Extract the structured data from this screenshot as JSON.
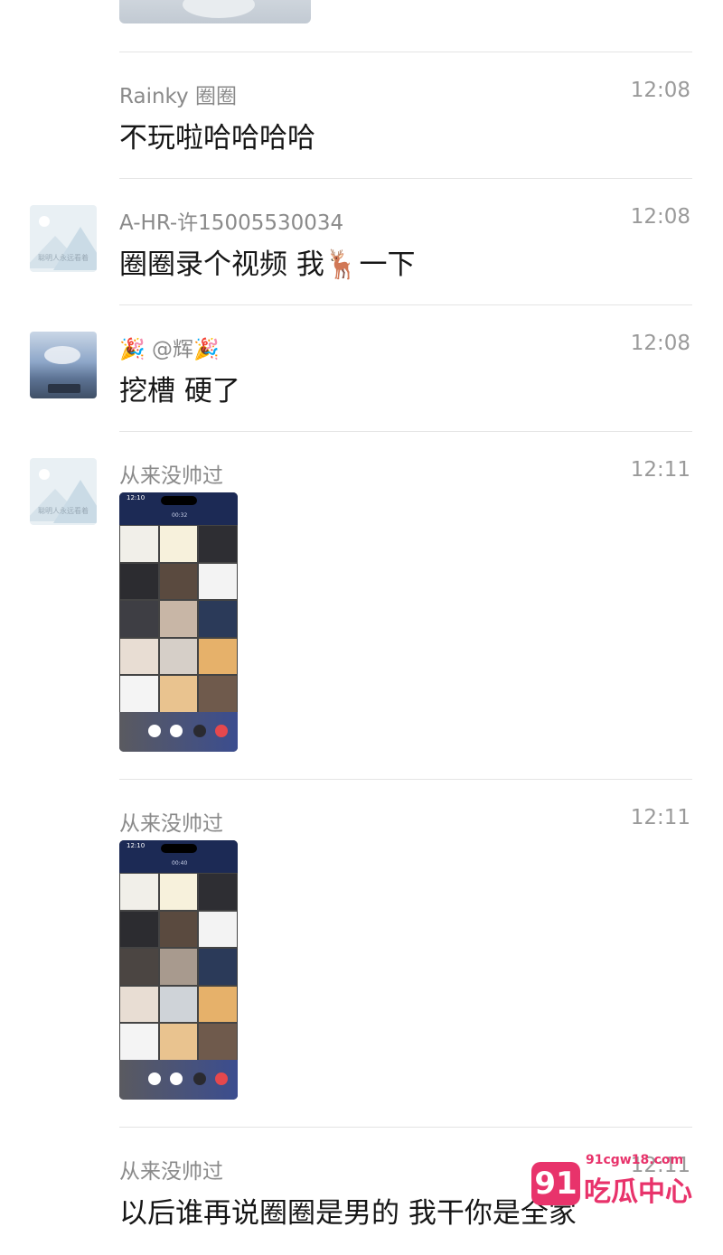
{
  "messages": [
    {
      "name": "Rainky 圈圈",
      "time": "12:08",
      "text": "不玩啦哈哈哈哈"
    },
    {
      "name": "A-HR-许15005530034",
      "time": "12:08",
      "text": "圈圈录个视频 我🦌一下",
      "avatar_caption": "聪明人永远看着"
    },
    {
      "name": "🎉 @辉🎉",
      "time": "12:08",
      "text": "挖槽 硬了"
    },
    {
      "name": "从来没帅过",
      "time": "12:11",
      "avatar_caption": "聪明人永远看着",
      "shot": {
        "clock": "12:10",
        "duration": "00:32"
      }
    },
    {
      "name": "从来没帅过",
      "time": "12:11",
      "shot": {
        "clock": "12:10",
        "duration": "00:40"
      }
    },
    {
      "name": "从来没帅过",
      "time": "12:11",
      "text": "以后谁再说圈圈是男的 我干你是全家"
    }
  ],
  "watermark": {
    "badge": "91",
    "url": "91cgw18.com",
    "title": "吃瓜中心"
  }
}
